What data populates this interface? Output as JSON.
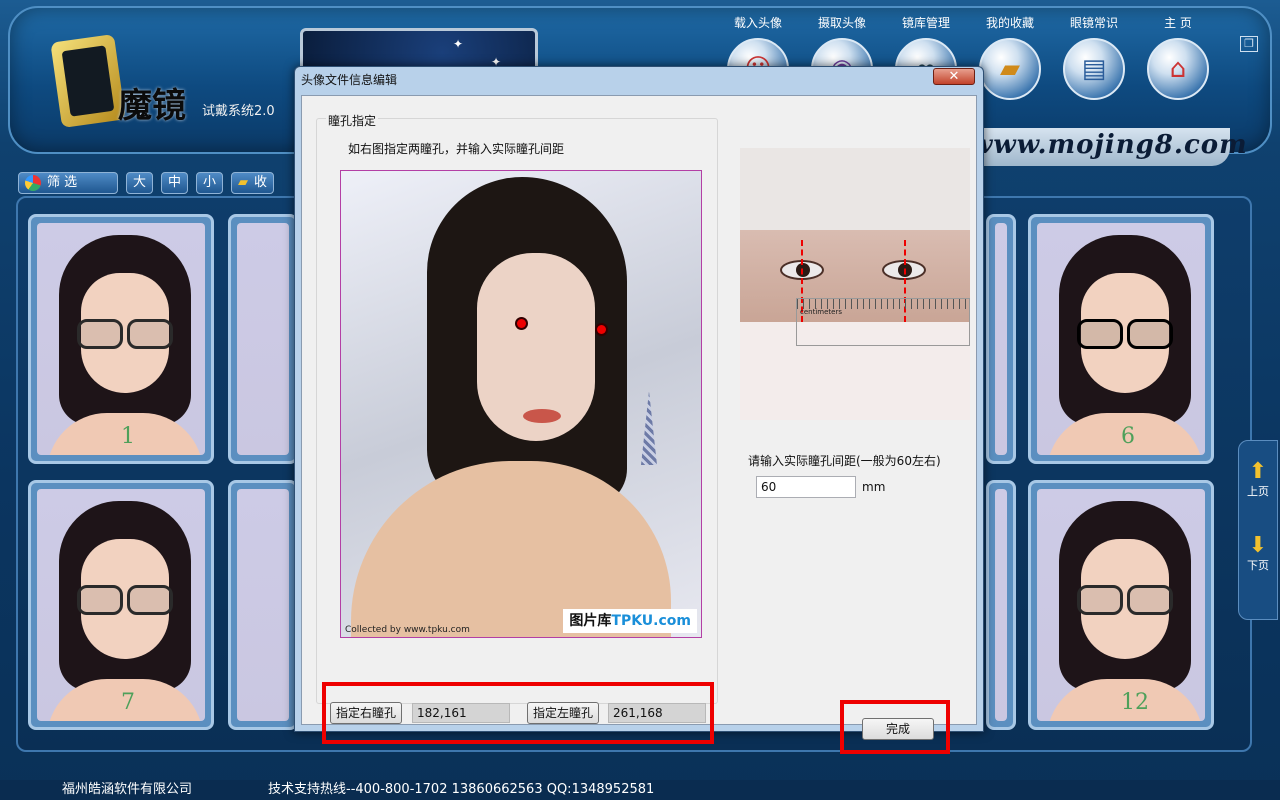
{
  "app": {
    "logo_text": "魔镜",
    "logo_subtitle": "试戴系统2.0",
    "url": "www.mojing8.com",
    "nav": [
      {
        "label": "载入头像",
        "icon": "face-load-icon"
      },
      {
        "label": "摄取头像",
        "icon": "webcam-icon"
      },
      {
        "label": "镜库管理",
        "icon": "glasses-library-icon"
      },
      {
        "label": "我的收藏",
        "icon": "folder-favorites-icon"
      },
      {
        "label": "眼镜常识",
        "icon": "book-icon"
      },
      {
        "label": "主 页",
        "icon": "home-icon"
      }
    ],
    "restore_symbol": "❐"
  },
  "toolbar": {
    "filter_label": "筛 选",
    "size_large": "大",
    "size_medium": "中",
    "size_small": "小",
    "collect_label": "收"
  },
  "gallery": {
    "cards": [
      {
        "number": "1",
        "glasses": "black-rim"
      },
      {
        "number": "6",
        "glasses": "sunglasses"
      },
      {
        "number": "7",
        "glasses": "dark-shades"
      },
      {
        "number": "12",
        "glasses": "black-rim"
      }
    ]
  },
  "pager": {
    "up_label": "上页",
    "down_label": "下页"
  },
  "footer": {
    "company": "福州皓涵软件有限公司",
    "hotline": "技术支持热线--400-800-1702 13860662563 QQ:1348952581"
  },
  "dialog": {
    "title": "头像文件信息编辑",
    "close_symbol": "✕",
    "group_label": "瞳孔指定",
    "instruction": "如右图指定两瞳孔，并输入实际瞳孔间距",
    "photo_watermark": "图片库",
    "photo_watermark_brand": "TPKU.com",
    "photo_credit": "Collected by www.tpku.com",
    "right_pupil_button": "指定右瞳孔",
    "right_pupil_value": "182,161",
    "left_pupil_button": "指定左瞳孔",
    "left_pupil_value": "261,168",
    "ruler_label": "centimeters",
    "pd_label": "请输入实际瞳孔间距(一般为60左右)",
    "pd_value": "60",
    "pd_unit": "mm",
    "done_button": "完成"
  }
}
